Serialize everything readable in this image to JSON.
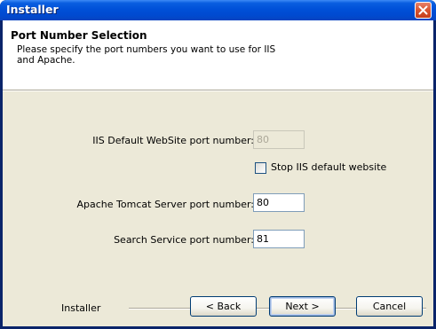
{
  "window": {
    "title": "Installer"
  },
  "header": {
    "title": "Port Number Selection",
    "description": "Please specify the port numbers you want to use for IIS and Apache."
  },
  "form": {
    "iis_label": "IIS Default WebSite port number:",
    "iis_value": "80",
    "stop_iis_label": "Stop IIS default website",
    "stop_iis_checked": false,
    "tomcat_label": "Apache Tomcat Server port number:",
    "tomcat_value": "80",
    "search_label": "Search Service port number:",
    "search_value": "81"
  },
  "footer": {
    "brand": "Installer",
    "back_label": "< Back",
    "next_label": "Next >",
    "cancel_label": "Cancel"
  },
  "colors": {
    "titlebar": "#0050d8",
    "dialog_background": "#ece9d8",
    "close_button": "#d8542f"
  }
}
